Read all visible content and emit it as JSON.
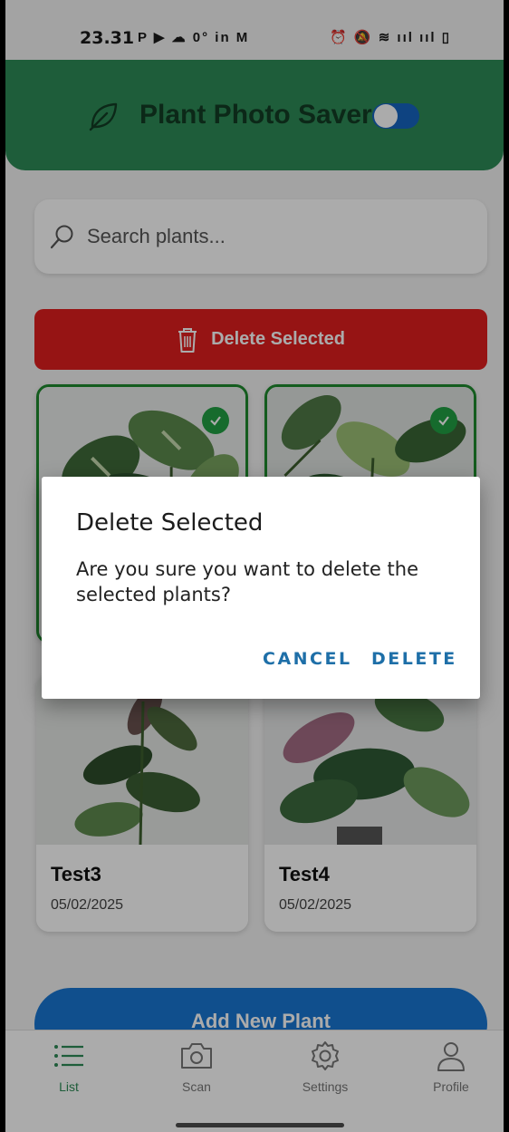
{
  "status_bar": {
    "time": "23.31",
    "left_icons": "P ▶ ☁ 0° in M",
    "right_icons": "⏰ 🔕 ≋ ııl ııl ▯"
  },
  "header": {
    "title": "Plant Photo Saver",
    "leaf_icon": "leaf-icon",
    "toggle_on": true
  },
  "search": {
    "placeholder": "Search plants...",
    "value": ""
  },
  "actions": {
    "delete_selected_label": "Delete Selected",
    "add_new_plant_label": "Add New Plant"
  },
  "plants": [
    {
      "name": "",
      "date": "",
      "selected": true
    },
    {
      "name": "",
      "date": "",
      "selected": true
    },
    {
      "name": "Test3",
      "date": "05/02/2025",
      "selected": false
    },
    {
      "name": "Test4",
      "date": "05/02/2025",
      "selected": false
    }
  ],
  "nav": {
    "items": [
      {
        "label": "List",
        "icon": "list-icon",
        "active": true
      },
      {
        "label": "Scan",
        "icon": "camera-icon",
        "active": false
      },
      {
        "label": "Settings",
        "icon": "gear-icon",
        "active": false
      },
      {
        "label": "Profile",
        "icon": "person-icon",
        "active": false
      }
    ]
  },
  "dialog": {
    "title": "Delete Selected",
    "message": "Are you sure you want to delete the selected plants?",
    "cancel_label": "CANCEL",
    "delete_label": "DELETE"
  },
  "colors": {
    "header_bg": "#2e8b57",
    "danger": "#e01f1f",
    "primary": "#1976d2",
    "dialog_button": "#1e6fa8",
    "selected_border": "#1f8a2d"
  }
}
